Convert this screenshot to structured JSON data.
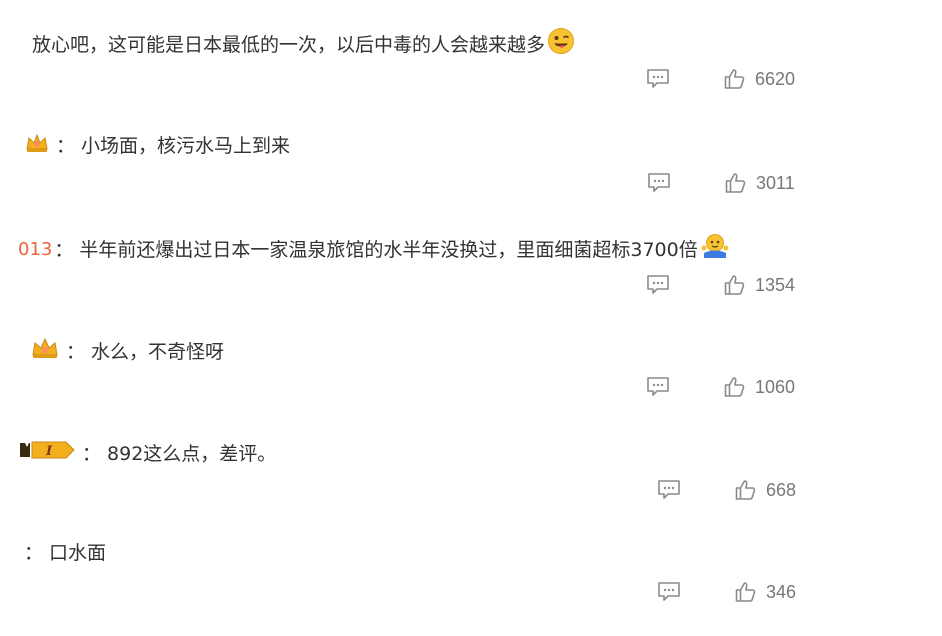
{
  "comments": [
    {
      "text": "放心吧，这可能是日本最低的一次，以后中毒的人会越来越多",
      "likes": "6620",
      "emoji": "tongue-out-face-icon"
    },
    {
      "prefix": "：",
      "text": "小场面，核污水马上到来",
      "likes": "3011",
      "badge": "crown-badge-icon"
    },
    {
      "prefix_name": "013",
      "prefix": "：",
      "text": "半年前还爆出过日本一家温泉旅馆的水半年没换过，里面细菌超标3700倍",
      "likes": "1354",
      "emoji": "shrug-face-icon"
    },
    {
      "prefix": "：",
      "text": "水么，不奇怪呀",
      "likes": "1060",
      "badge": "crown-badge-icon"
    },
    {
      "prefix": "：",
      "text": "892这么点，差评。",
      "likes": "668",
      "badge": "level-1-badge-icon",
      "badge_text": "I"
    },
    {
      "prefix": "：",
      "text": "口水面",
      "likes": "346"
    }
  ],
  "colors": {
    "text": "#333333",
    "muted": "#777777",
    "icon": "#8a8a8a",
    "partial_name": "#e8643c",
    "badge_gold": "#f2b01e"
  }
}
